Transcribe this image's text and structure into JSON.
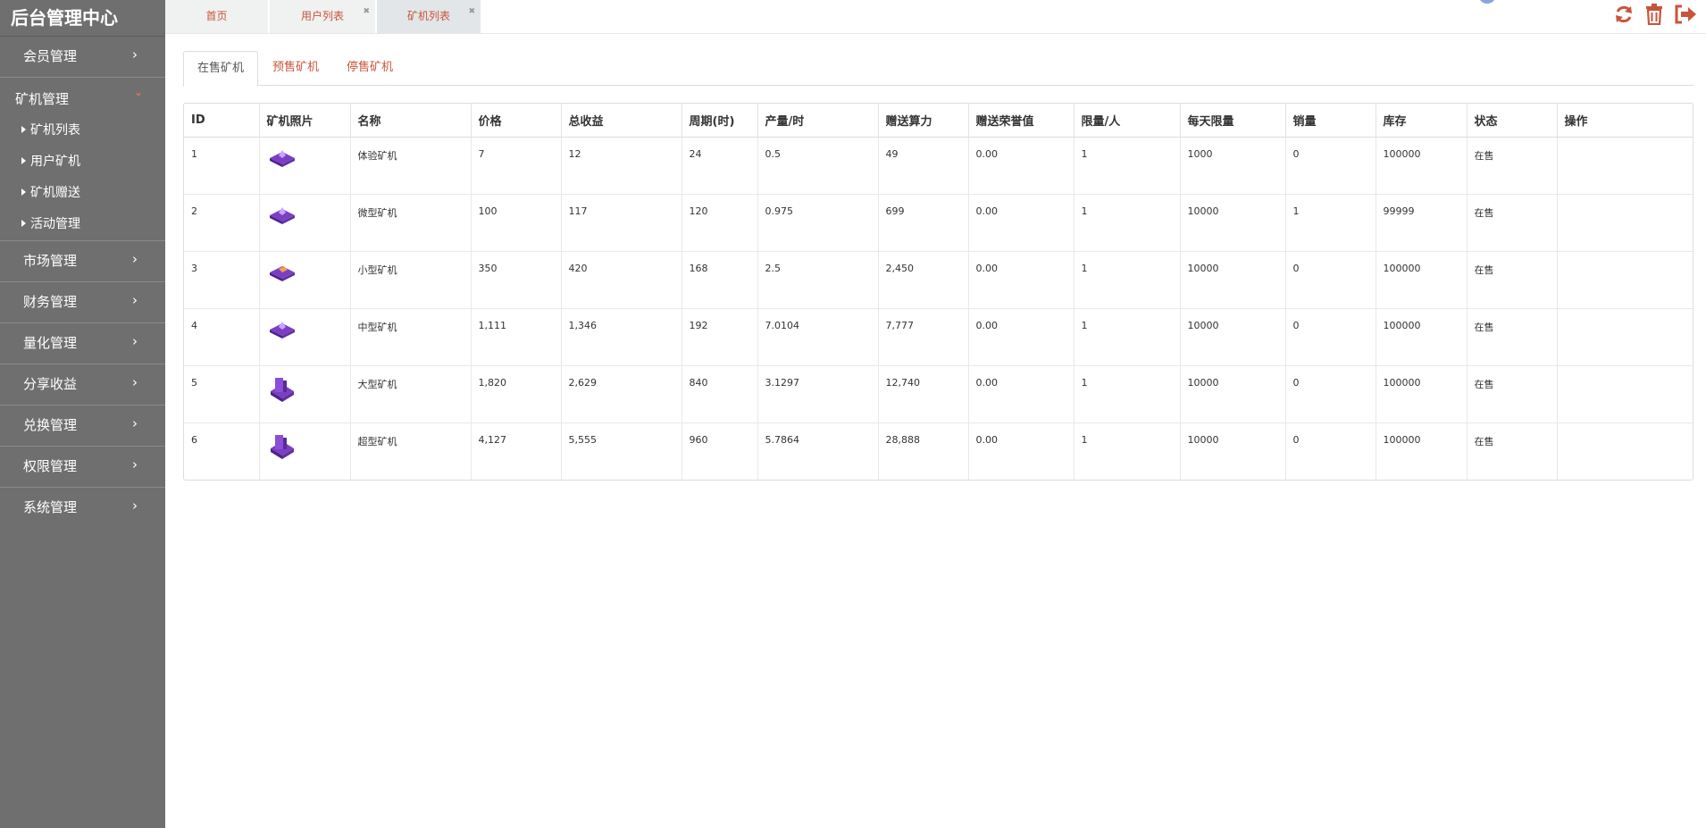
{
  "app": {
    "title": "后台管理中心"
  },
  "sidebar": {
    "groups": [
      {
        "label": "会员管理"
      },
      {
        "label": "矿机管理",
        "open": true,
        "children": [
          "矿机列表",
          "用户矿机",
          "矿机赠送",
          "活动管理"
        ]
      },
      {
        "label": "市场管理"
      },
      {
        "label": "财务管理"
      },
      {
        "label": "量化管理"
      },
      {
        "label": "分享收益"
      },
      {
        "label": "兑换管理"
      },
      {
        "label": "权限管理"
      },
      {
        "label": "系统管理"
      }
    ]
  },
  "top_tabs": [
    {
      "label": "首页"
    },
    {
      "label": "用户列表",
      "closable": true
    },
    {
      "label": "矿机列表",
      "closable": true,
      "active": true
    }
  ],
  "top_icons": [
    "refresh-icon",
    "trash-icon",
    "logout-icon"
  ],
  "sub_tabs": [
    {
      "label": "在售矿机",
      "active": true
    },
    {
      "label": "预售矿机"
    },
    {
      "label": "停售矿机"
    }
  ],
  "colors": {
    "accent": "#c8553a",
    "sidebar_bg": "#6f6f6f",
    "machine_purple": "#7b3fc4"
  },
  "table": {
    "headers": [
      "ID",
      "矿机照片",
      "名称",
      "价格",
      "总收益",
      "周期(时)",
      "产量/时",
      "赠送算力",
      "赠送荣誉值",
      "限量/人",
      "每天限量",
      "销量",
      "库存",
      "状态",
      "操作"
    ],
    "rows": [
      {
        "id": "1",
        "name": "体验矿机",
        "price": "7",
        "total": "12",
        "cycle": "24",
        "rate": "0.5",
        "power": "49",
        "honor": "0.00",
        "limit": "1",
        "daily": "1000",
        "sold": "0",
        "stock": "100000",
        "status": "在售",
        "action": "",
        "icon": "flat-miner-icon"
      },
      {
        "id": "2",
        "name": "微型矿机",
        "price": "100",
        "total": "117",
        "cycle": "120",
        "rate": "0.975",
        "power": "699",
        "honor": "0.00",
        "limit": "1",
        "daily": "10000",
        "sold": "1",
        "stock": "99999",
        "status": "在售",
        "action": "",
        "icon": "flat-miner-icon"
      },
      {
        "id": "3",
        "name": "小型矿机",
        "price": "350",
        "total": "420",
        "cycle": "168",
        "rate": "2.5",
        "power": "2,450",
        "honor": "0.00",
        "limit": "1",
        "daily": "10000",
        "sold": "0",
        "stock": "100000",
        "status": "在售",
        "action": "",
        "icon": "flat-miner-gold-icon"
      },
      {
        "id": "4",
        "name": "中型矿机",
        "price": "1,111",
        "total": "1,346",
        "cycle": "192",
        "rate": "7.0104",
        "power": "7,777",
        "honor": "0.00",
        "limit": "1",
        "daily": "10000",
        "sold": "0",
        "stock": "100000",
        "status": "在售",
        "action": "",
        "icon": "flat-miner-icon"
      },
      {
        "id": "5",
        "name": "大型矿机",
        "price": "1,820",
        "total": "2,629",
        "cycle": "840",
        "rate": "3.1297",
        "power": "12,740",
        "honor": "0.00",
        "limit": "1",
        "daily": "10000",
        "sold": "0",
        "stock": "100000",
        "status": "在售",
        "action": "",
        "icon": "tower-miner-icon"
      },
      {
        "id": "6",
        "name": "超型矿机",
        "price": "4,127",
        "total": "5,555",
        "cycle": "960",
        "rate": "5.7864",
        "power": "28,888",
        "honor": "0.00",
        "limit": "1",
        "daily": "10000",
        "sold": "0",
        "stock": "100000",
        "status": "在售",
        "action": "",
        "icon": "tower-miner-icon"
      }
    ]
  }
}
